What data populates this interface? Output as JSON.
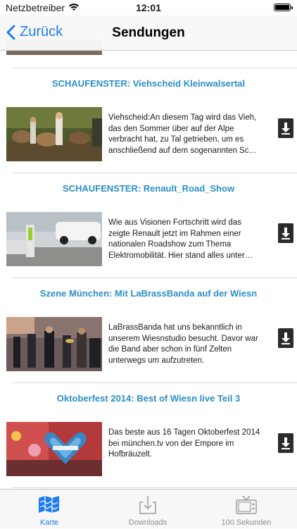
{
  "status_bar": {
    "carrier": "Netzbetreiber",
    "time": "12:01"
  },
  "nav": {
    "back_label": "Zurück",
    "title": "Sendungen"
  },
  "items": [
    {
      "title": "SCHAUFENSTER: Viehscheid Kleinwalsertal",
      "description": "Viehscheid:An diesem Tag wird das Vieh, das den Sommer über auf der Alpe verbracht hat, zu Tal getrieben, um es anschließend auf dem sogenannten Sc…"
    },
    {
      "title": "SCHAUFENSTER: Renault_Road_Show",
      "description": "Wie aus Visionen Fortschritt wird das zeigte Renault jetzt im Rahmen einer nationalen Roadshow zum Thema Elektromobilität. Hier stand alles unter…"
    },
    {
      "title": "Szene München: Mit LaBrassBanda auf der Wiesn",
      "description": "LaBrassBanda hat uns bekanntlich in unserem Wiesnstudio besucht. Davor war die Band aber schon in fünf Zelten unterwegs um aufzutreten."
    },
    {
      "title": "Oktoberfest 2014: Best of Wiesn live Teil 3",
      "description": "Das beste aus 16 Tagen Oktoberfest 2014 bei münchen.tv von der Empore im Hofbräuzelt."
    }
  ],
  "tabs": [
    {
      "label": "Karte",
      "icon": "map-icon",
      "active": true
    },
    {
      "label": "Downloads",
      "icon": "download-tray-icon",
      "active": false
    },
    {
      "label": "100 Sekunden",
      "icon": "tv-icon",
      "active": false
    }
  ],
  "colors": {
    "accent": "#1e7cf2",
    "item_title": "#2a8fc9",
    "download_button": "#2b2b2b"
  }
}
